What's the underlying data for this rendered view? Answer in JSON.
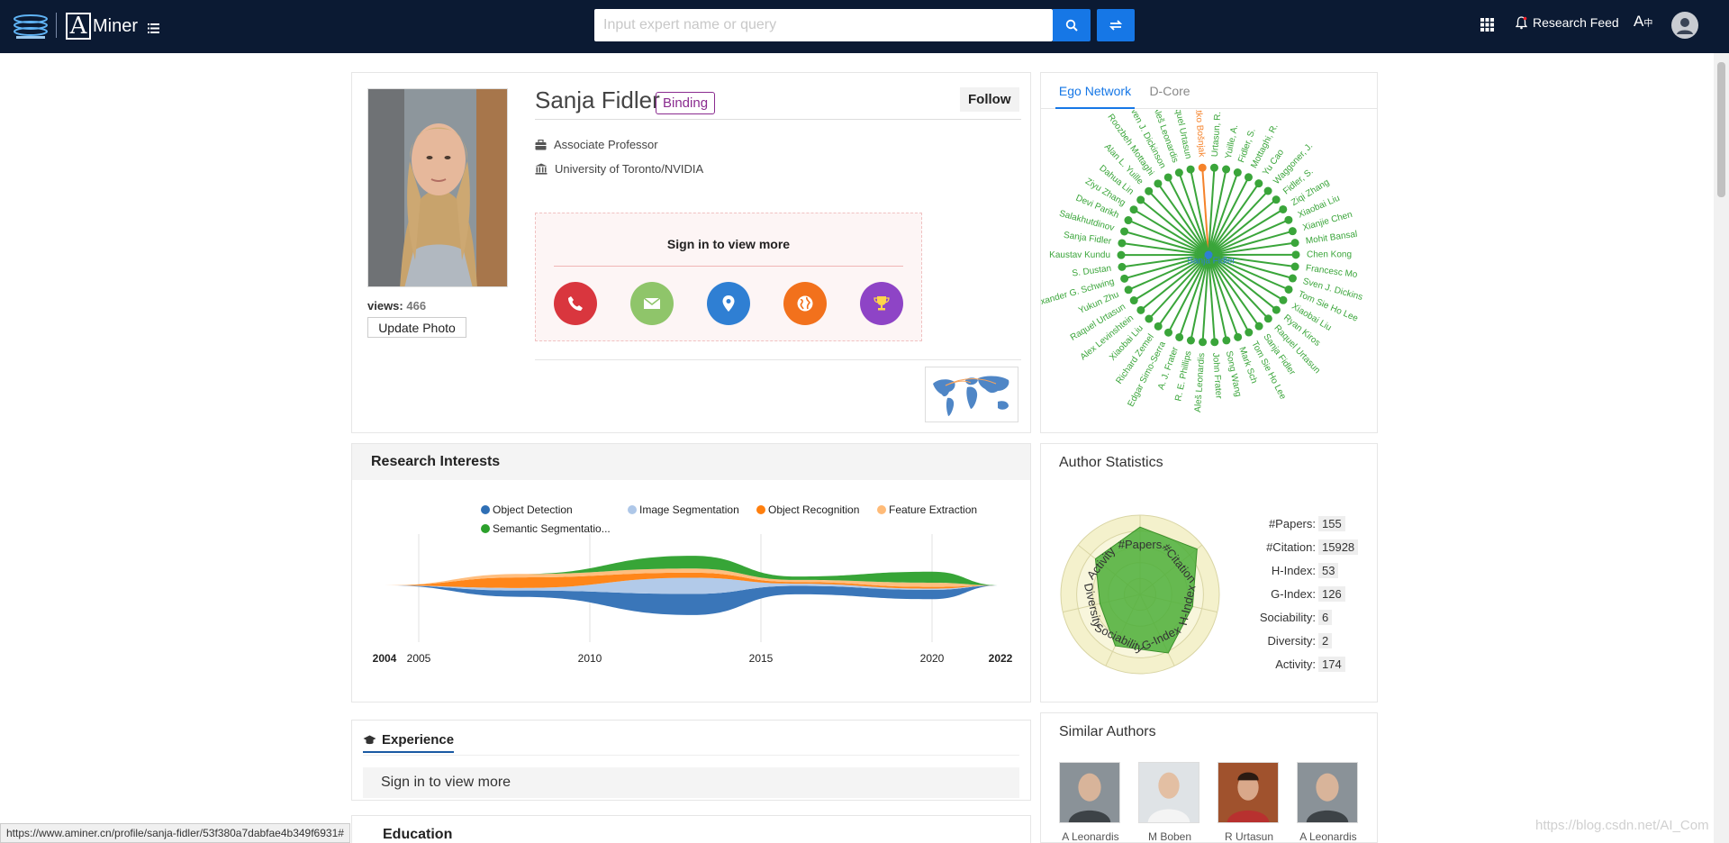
{
  "header": {
    "brand": "Miner",
    "search_placeholder": "Input expert name or query",
    "research_feed": "Research Feed"
  },
  "profile": {
    "name": "Sanja Fidler",
    "binding": "Binding",
    "follow": "Follow",
    "position": "Associate Professor",
    "affiliation": "University of Toronto/NVIDIA",
    "views_label": "views:",
    "views": "466",
    "update_photo": "Update Photo",
    "sign_in": "Sign in to view more",
    "contact_icons": [
      "phone-icon",
      "email-icon",
      "location-icon",
      "globe-icon",
      "trophy-icon"
    ],
    "contact_colors": [
      "#d9363e",
      "#8fc56a",
      "#2f7fd3",
      "#f2711c",
      "#8e44c6"
    ]
  },
  "ego": {
    "tabs": [
      "Ego Network",
      "D-Core"
    ],
    "center": "Sanja Fidler",
    "highlight_color": "#f5822a",
    "edge_color": "#3aa53a",
    "nodes": [
      "Matko Bošnjak",
      "Urtasun, R.",
      "Yuille, A.",
      "Fidler, S.",
      "Mottaghi, R.",
      "Yu Cao",
      "Waggoner, J.",
      "Fidler, S.",
      "Ziqi Zhang",
      "Xiaobai Liu",
      "Xianjie Chen",
      "Mohit Bansal",
      "Chen Kong",
      "Francesc Mo",
      "Sven J. Dickins",
      "Tom Sie Ho Lee",
      "Xiaobai Liu",
      "Ryan Kiros",
      "Raquel Urtasun",
      "Sanja Fidler",
      "Tom Sie Ho Lee",
      "Mark Sch",
      "Song Wang",
      "John Frater",
      "Aleš Leonardis",
      "R. E. Phillips",
      "A. J. Frater",
      "Edgar Simo-Serra",
      "Richard Zemel",
      "Xiaobai Liu",
      "Alex Levinshtein",
      "Raquel Urtasun",
      "Yukun Zhu",
      "Alexander G. Schwing",
      "S. Dustan",
      "Kaustav Kundu",
      "Sanja Fidler",
      "Salakhutdinov",
      "Devi Parikh",
      "Ziyu Zhang",
      "Dahua Lin",
      "Alan L. Yuille",
      "Roozbeh Mottaghi",
      "Sven J. Dickinson",
      "Aleš Leonardis",
      "Raquel Urtasun"
    ]
  },
  "interests": {
    "title": "Research Interests",
    "legend": [
      "Object Detection",
      "Image Segmentation",
      "Object Recognition",
      "Feature Extraction",
      "Semantic Segmentatio..."
    ],
    "colors": [
      "#2f6fb5",
      "#aec7e8",
      "#ff7f0e",
      "#ffbb78",
      "#2ca02c"
    ],
    "axis_ticks": [
      "2004",
      "2005",
      "2010",
      "2015",
      "2020",
      "2022"
    ]
  },
  "chart_data": {
    "type": "area",
    "title": "Research Interests",
    "x": [
      2004,
      2008,
      2013,
      2016,
      2020,
      2022
    ],
    "xlim": [
      2004,
      2022
    ],
    "grid": true,
    "legend_position": "top",
    "series": [
      {
        "name": "Object Detection",
        "values": [
          0,
          1.5,
          5,
          2,
          2.2,
          0
        ]
      },
      {
        "name": "Image Segmentation",
        "values": [
          0,
          0.6,
          3.8,
          0.5,
          0.3,
          0
        ]
      },
      {
        "name": "Object Recognition",
        "values": [
          0,
          2.5,
          1.2,
          0.4,
          0.4,
          0
        ]
      },
      {
        "name": "Feature Extraction",
        "values": [
          0,
          0.8,
          1.0,
          0.5,
          1.0,
          0
        ]
      },
      {
        "name": "Semantic Segmentatio...",
        "values": [
          0,
          0,
          3,
          0.8,
          2.6,
          0
        ]
      }
    ]
  },
  "stats": {
    "title": "Author Statistics",
    "rows": [
      {
        "label": "#Papers:",
        "value": "155"
      },
      {
        "label": "#Citation:",
        "value": "15928"
      },
      {
        "label": "H-Index:",
        "value": "53"
      },
      {
        "label": "G-Index:",
        "value": "126"
      },
      {
        "label": "Sociability:",
        "value": "6"
      },
      {
        "label": "Diversity:",
        "value": "2"
      },
      {
        "label": "Activity:",
        "value": "174"
      }
    ],
    "radar_labels": [
      "#Papers",
      "#Citation",
      "H-Index",
      "G-Index",
      "Sociability",
      "Diversity",
      "Activity"
    ],
    "radar_levels": [
      0.85,
      0.92,
      0.68,
      0.82,
      0.72,
      0.52,
      0.72
    ]
  },
  "experience": {
    "title": "Experience",
    "sign_in": "Sign in to view more"
  },
  "education": {
    "title": "Education"
  },
  "similar": {
    "title": "Similar Authors",
    "authors": [
      "A Leonardis",
      "M Boben",
      "R Urtasun",
      "A Leonardis"
    ]
  },
  "status_url": "https://www.aminer.cn/profile/sanja-fidler/53f380a7dabfae4b349f6931#",
  "watermark": "https://blog.csdn.net/AI_Com"
}
